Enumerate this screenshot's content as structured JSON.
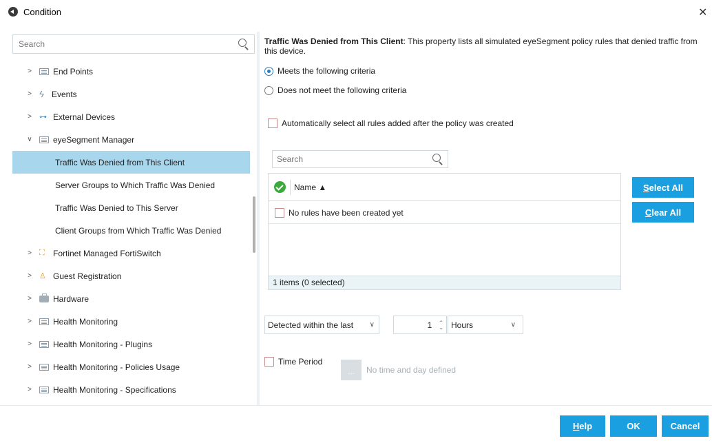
{
  "window": {
    "title": "Condition",
    "close_glyph": "✕"
  },
  "tree": {
    "search_placeholder": "Search",
    "items": [
      {
        "label": "End Points",
        "icon": "list-icon",
        "expanded": false
      },
      {
        "label": "Events",
        "icon": "bolt-icon",
        "expanded": false
      },
      {
        "label": "External Devices",
        "icon": "usb-icon",
        "expanded": false
      },
      {
        "label": "eyeSegment Manager",
        "icon": "list-icon",
        "expanded": true
      },
      {
        "label": "Traffic Was Denied from This Client",
        "child": true,
        "selected": true
      },
      {
        "label": "Server Groups to Which Traffic Was Denied",
        "child": true
      },
      {
        "label": "Traffic Was Denied to This Server",
        "child": true
      },
      {
        "label": "Client Groups from Which Traffic Was Denied",
        "child": true
      },
      {
        "label": "Fortinet Managed FortiSwitch",
        "icon": "network-switch-icon",
        "expanded": false
      },
      {
        "label": "Guest Registration",
        "icon": "guest-icon",
        "expanded": false
      },
      {
        "label": "Hardware",
        "icon": "hardware-icon",
        "expanded": false
      },
      {
        "label": "Health Monitoring",
        "icon": "list-icon",
        "expanded": false
      },
      {
        "label": "Health Monitoring - Plugins",
        "icon": "list-icon",
        "expanded": false
      },
      {
        "label": "Health Monitoring - Policies Usage",
        "icon": "list-icon",
        "expanded": false
      },
      {
        "label": "Health Monitoring - Specifications",
        "icon": "list-icon",
        "expanded": false
      }
    ]
  },
  "property": {
    "title": "Traffic Was Denied from This Client",
    "description": ": This property lists all simulated eyeSegment policy rules that denied traffic from this device."
  },
  "criteria": {
    "meets_label": "Meets the following criteria",
    "not_meets_label": "Does not meet the following criteria",
    "selected": "meets"
  },
  "auto_select_label": "Automatically select all rules added after the policy was created",
  "rules": {
    "search_placeholder": "Search",
    "column_name": "Name ▲",
    "empty_text": "No rules have been created yet",
    "footer": "1 items (0 selected)",
    "select_all_label": "elect All",
    "select_all_key": "S",
    "clear_all_label": "lear All",
    "clear_all_key": "C"
  },
  "detected": {
    "mode": "Detected within the last",
    "quantity": "1",
    "unit": "Hours"
  },
  "time_period": {
    "label": "Time Period",
    "button_label": "...",
    "none_text": "No time and day defined"
  },
  "footer_buttons": {
    "help_key": "H",
    "help_rest": "elp",
    "ok": "OK",
    "cancel": "Cancel"
  },
  "colors": {
    "accent": "#1aa0e0",
    "selected_row": "#a8d6ec"
  }
}
